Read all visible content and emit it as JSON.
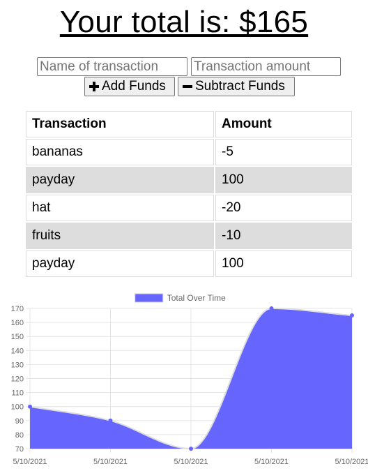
{
  "header": {
    "total_text": "Your total is: $165"
  },
  "form": {
    "name_placeholder": "Name of transaction",
    "amount_placeholder": "Transaction amount",
    "add_label": "Add Funds",
    "subtract_label": "Subtract Funds"
  },
  "table": {
    "headers": [
      "Transaction",
      "Amount"
    ],
    "rows": [
      {
        "name": "bananas",
        "amount": "-5"
      },
      {
        "name": "payday",
        "amount": "100"
      },
      {
        "name": "hat",
        "amount": "-20"
      },
      {
        "name": "fruits",
        "amount": "-10"
      },
      {
        "name": "payday",
        "amount": "100"
      }
    ]
  },
  "chart_data": {
    "type": "area",
    "x": [
      "5/10/2021",
      "5/10/2021",
      "5/10/2021",
      "5/10/2021",
      "5/10/2021"
    ],
    "series": [
      {
        "name": "Total Over Time",
        "values": [
          100,
          90,
          70,
          170,
          165
        ]
      }
    ],
    "ylim": [
      70,
      170
    ],
    "yticks": [
      70,
      80,
      90,
      100,
      110,
      120,
      130,
      140,
      150,
      160,
      170
    ],
    "grid": true,
    "legend": "top",
    "fill_color": "#6666ff",
    "line_color": "#dddddd",
    "point_color": "#6666ff"
  }
}
